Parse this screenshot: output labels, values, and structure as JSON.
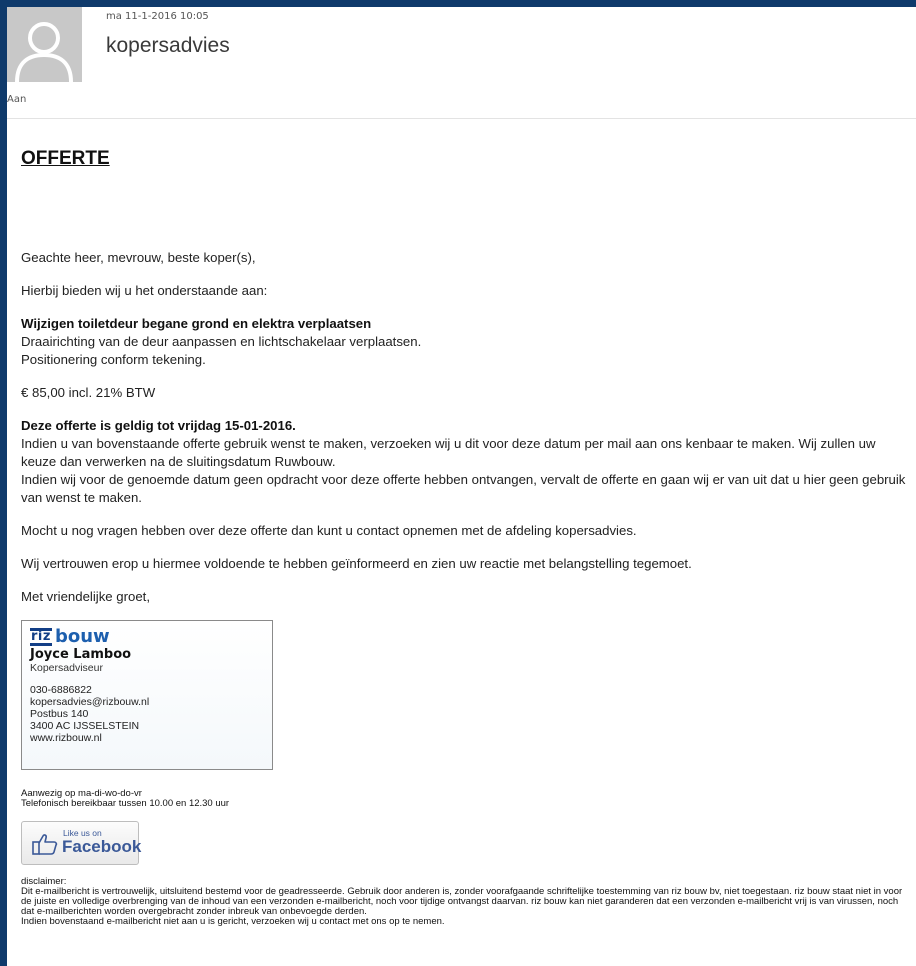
{
  "header": {
    "datetime": "ma 11-1-2016 10:05",
    "sender": "kopersadvies",
    "to_label": "Aan"
  },
  "body": {
    "title": "OFFERTE",
    "greeting": "Geachte heer, mevrouw, beste koper(s),",
    "intro": "Hierbij bieden wij u het onderstaande aan:",
    "item_title": "Wijzigen toiletdeur begane grond en elektra verplaatsen",
    "item_line1": "Draairichting van de deur aanpassen en lichtschakelaar verplaatsen.",
    "item_line2": "Positionering conform tekening.",
    "price": "€ 85,00 incl. 21% BTW",
    "validity_title": "Deze offerte is geldig tot vrijdag 15-01-2016.",
    "validity_line1": "Indien u van bovenstaande offerte gebruik wenst te maken, verzoeken wij u dit voor deze datum per mail aan ons kenbaar te maken. Wij zullen uw keuze dan verwerken na de sluitingsdatum Ruwbouw.",
    "validity_line2": "Indien wij voor de genoemde datum geen opdracht voor deze offerte hebben ontvangen, vervalt de offerte en gaan wij er van uit dat u hier geen gebruik van wenst te maken.",
    "questions": "Mocht u nog vragen hebben over deze offerte dan kunt u contact opnemen met de afdeling kopersadvies.",
    "trust": "Wij vertrouwen erop u hiermee voldoende te hebben geïnformeerd en zien uw reactie met belangstelling tegemoet.",
    "closing": "Met vriendelijke groet,"
  },
  "signature": {
    "logo_riz": "riz",
    "logo_bouw": "bouw",
    "name": "Joyce Lamboo",
    "role": "Kopersadviseur",
    "phone": "030-6886822",
    "email": "kopersadvies@rizbouw.nl",
    "postbus": "Postbus 140",
    "city": "3400 AC  IJSSELSTEIN",
    "website": "www.rizbouw.nl"
  },
  "availability": {
    "days": "Aanwezig op ma-di-wo-do-vr",
    "phone_hours": "Telefonisch bereikbaar tussen 10.00 en 12.30 uur"
  },
  "facebook": {
    "like": "Like us on",
    "name": "Facebook",
    "brand_color": "#3b5998"
  },
  "disclaimer": {
    "label": "disclaimer:",
    "line1": "Dit e-mailbericht is vertrouwelijk, uitsluitend bestemd voor de geadresseerde. Gebruik door anderen is, zonder voorafgaande schriftelijke toestemming van riz bouw bv, niet toegestaan. riz bouw staat niet in voor de juiste en volledige overbrenging van de inhoud van een verzonden e-mailbericht, noch voor tijdige ontvangst daarvan. riz bouw kan niet garanderen dat een verzonden e-mailbericht vrij is van virussen, noch dat e-mailberichten worden overgebracht zonder inbreuk van onbevoegde derden.",
    "line2": "Indien bovenstaand e-mailbericht niet aan u is gericht, verzoeken wij u contact met ons op te nemen."
  },
  "icons": {
    "avatar": "person-silhouette-icon",
    "like": "thumbs-up-icon"
  },
  "colors": {
    "frame_background": "#0f3a6b",
    "logo_blue": "#1d5fae"
  }
}
